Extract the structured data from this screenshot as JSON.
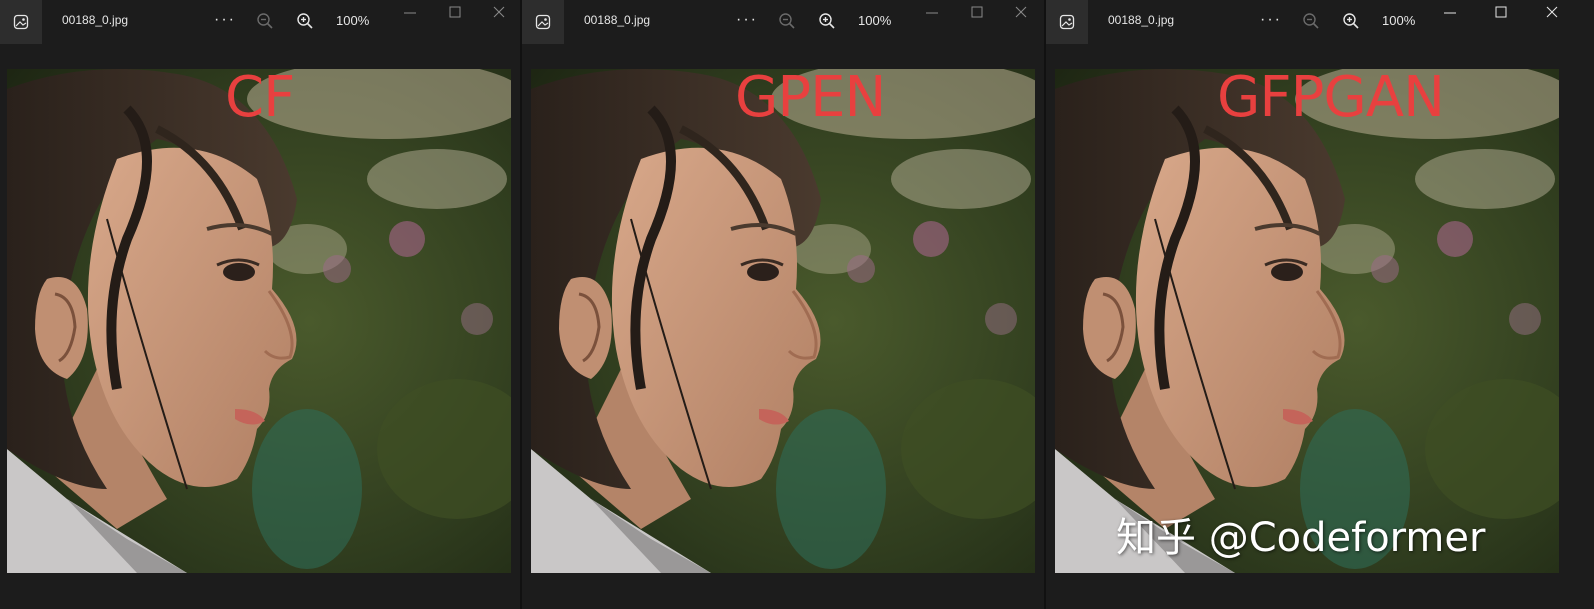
{
  "viewers": [
    {
      "filename": "00188_0.jpg",
      "more_label": "···",
      "zoom_level": "100%",
      "method_label": "CF"
    },
    {
      "filename": "00188_0.jpg",
      "more_label": "···",
      "zoom_level": "100%",
      "method_label": "GPEN"
    },
    {
      "filename": "00188_0.jpg",
      "more_label": "···",
      "zoom_level": "100%",
      "method_label": "GFPGAN",
      "watermark": "知乎 @Codeformer"
    }
  ],
  "icons": {
    "app": "photos-app-icon",
    "zoom_out": "zoom-out-icon",
    "zoom_in": "zoom-in-icon",
    "minimize": "minimize-icon",
    "maximize": "maximize-icon",
    "close": "close-icon"
  },
  "colors": {
    "background": "#1c1c1c",
    "label": "#e8403f"
  }
}
